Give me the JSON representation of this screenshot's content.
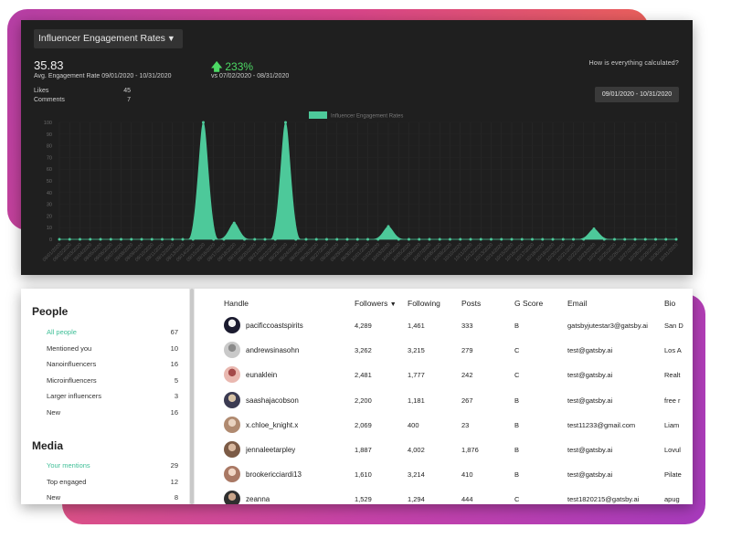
{
  "chart": {
    "metric_label": "Influencer Engagement Rates",
    "avg_value": "35.83",
    "avg_caption": "Avg. Engagement Rate 09/01/2020 - 10/31/2020",
    "change_value": "233%",
    "change_caption": "vs 07/02/2020 - 08/31/2020",
    "likes_label": "Likes",
    "likes_value": "45",
    "comments_label": "Comments",
    "comments_value": "7",
    "calc_link": "How is everything calculated?",
    "date_range": "09/01/2020 - 10/31/2020",
    "colors": {
      "series": "#4dc99a",
      "background": "#1f1f1f",
      "change": "#4cd964"
    }
  },
  "chart_data": {
    "type": "area",
    "title": "",
    "legend": [
      "Influencer Engagement Rates"
    ],
    "legend_position": "top",
    "ylim": [
      0,
      100
    ],
    "yticks": [
      0,
      10,
      20,
      30,
      40,
      50,
      60,
      70,
      80,
      90,
      100
    ],
    "grid": true,
    "x": [
      "09/01/2020",
      "09/02/2020",
      "09/03/2020",
      "09/04/2020",
      "09/05/2020",
      "09/06/2020",
      "09/07/2020",
      "09/08/2020",
      "09/09/2020",
      "09/10/2020",
      "09/11/2020",
      "09/12/2020",
      "09/13/2020",
      "09/14/2020",
      "09/15/2020",
      "09/16/2020",
      "09/17/2020",
      "09/18/2020",
      "09/19/2020",
      "09/20/2020",
      "09/21/2020",
      "09/22/2020",
      "09/23/2020",
      "09/24/2020",
      "09/25/2020",
      "09/26/2020",
      "09/27/2020",
      "09/28/2020",
      "09/29/2020",
      "09/30/2020",
      "10/01/2020",
      "10/02/2020",
      "10/03/2020",
      "10/04/2020",
      "10/05/2020",
      "10/06/2020",
      "10/07/2020",
      "10/08/2020",
      "10/09/2020",
      "10/10/2020",
      "10/11/2020",
      "10/12/2020",
      "10/13/2020",
      "10/14/2020",
      "10/15/2020",
      "10/16/2020",
      "10/17/2020",
      "10/18/2020",
      "10/19/2020",
      "10/20/2020",
      "10/21/2020",
      "10/22/2020",
      "10/23/2020",
      "10/24/2020",
      "10/25/2020",
      "10/26/2020",
      "10/27/2020",
      "10/28/2020",
      "10/29/2020",
      "10/30/2020",
      "10/31/2020"
    ],
    "series": [
      {
        "name": "Influencer Engagement Rates",
        "values": [
          0,
          0,
          0,
          0,
          0,
          0,
          0,
          0,
          0,
          0,
          0,
          0,
          0,
          0,
          100,
          0,
          0,
          14,
          0,
          0,
          0,
          0,
          100,
          0,
          0,
          0,
          0,
          0,
          0,
          0,
          0,
          0,
          11,
          0,
          0,
          0,
          0,
          0,
          0,
          0,
          0,
          0,
          0,
          0,
          0,
          0,
          0,
          0,
          0,
          0,
          0,
          0,
          9,
          0,
          0,
          0,
          0,
          0,
          0,
          0,
          0
        ]
      }
    ]
  },
  "sidebar": {
    "people_heading": "People",
    "people_items": [
      {
        "label": "All people",
        "count": "67"
      },
      {
        "label": "Mentioned you",
        "count": "10"
      },
      {
        "label": "Nanoinfluencers",
        "count": "16"
      },
      {
        "label": "Microinfluencers",
        "count": "5"
      },
      {
        "label": "Larger influencers",
        "count": "3"
      },
      {
        "label": "New",
        "count": "16"
      }
    ],
    "media_heading": "Media",
    "media_items": [
      {
        "label": "Your mentions",
        "count": "29"
      },
      {
        "label": "Top engaged",
        "count": "12"
      },
      {
        "label": "New",
        "count": "8"
      }
    ]
  },
  "table": {
    "headers": {
      "handle": "Handle",
      "followers": "Followers",
      "following": "Following",
      "posts": "Posts",
      "gscore": "G Score",
      "email": "Email",
      "bio": "Bio"
    },
    "rows": [
      {
        "handle": "pacificcoastspirits",
        "followers": "4,289",
        "following": "1,461",
        "posts": "333",
        "gscore": "B",
        "email": "gatsbyjutestar3@gatsby.ai",
        "bio": "San D"
      },
      {
        "handle": "andrewsinasohn",
        "followers": "3,262",
        "following": "3,215",
        "posts": "279",
        "gscore": "C",
        "email": "test@gatsby.ai",
        "bio": "Los A"
      },
      {
        "handle": "eunaklein",
        "followers": "2,481",
        "following": "1,777",
        "posts": "242",
        "gscore": "C",
        "email": "test@gatsby.ai",
        "bio": "Realt"
      },
      {
        "handle": "saashajacobson",
        "followers": "2,200",
        "following": "1,181",
        "posts": "267",
        "gscore": "B",
        "email": "test@gatsby.ai",
        "bio": "free r"
      },
      {
        "handle": "x.chloe_knight.x",
        "followers": "2,069",
        "following": "400",
        "posts": "23",
        "gscore": "B",
        "email": "test11233@gmail.com",
        "bio": "Liam"
      },
      {
        "handle": "jennaleetarpley",
        "followers": "1,887",
        "following": "4,002",
        "posts": "1,876",
        "gscore": "B",
        "email": "test@gatsby.ai",
        "bio": "Lovul"
      },
      {
        "handle": "brookericciardi13",
        "followers": "1,610",
        "following": "3,214",
        "posts": "410",
        "gscore": "B",
        "email": "test@gatsby.ai",
        "bio": "Pilate"
      },
      {
        "handle": "zeanna",
        "followers": "1,529",
        "following": "1,294",
        "posts": "444",
        "gscore": "C",
        "email": "test1820215@gatsby.ai",
        "bio": "apug"
      }
    ]
  }
}
